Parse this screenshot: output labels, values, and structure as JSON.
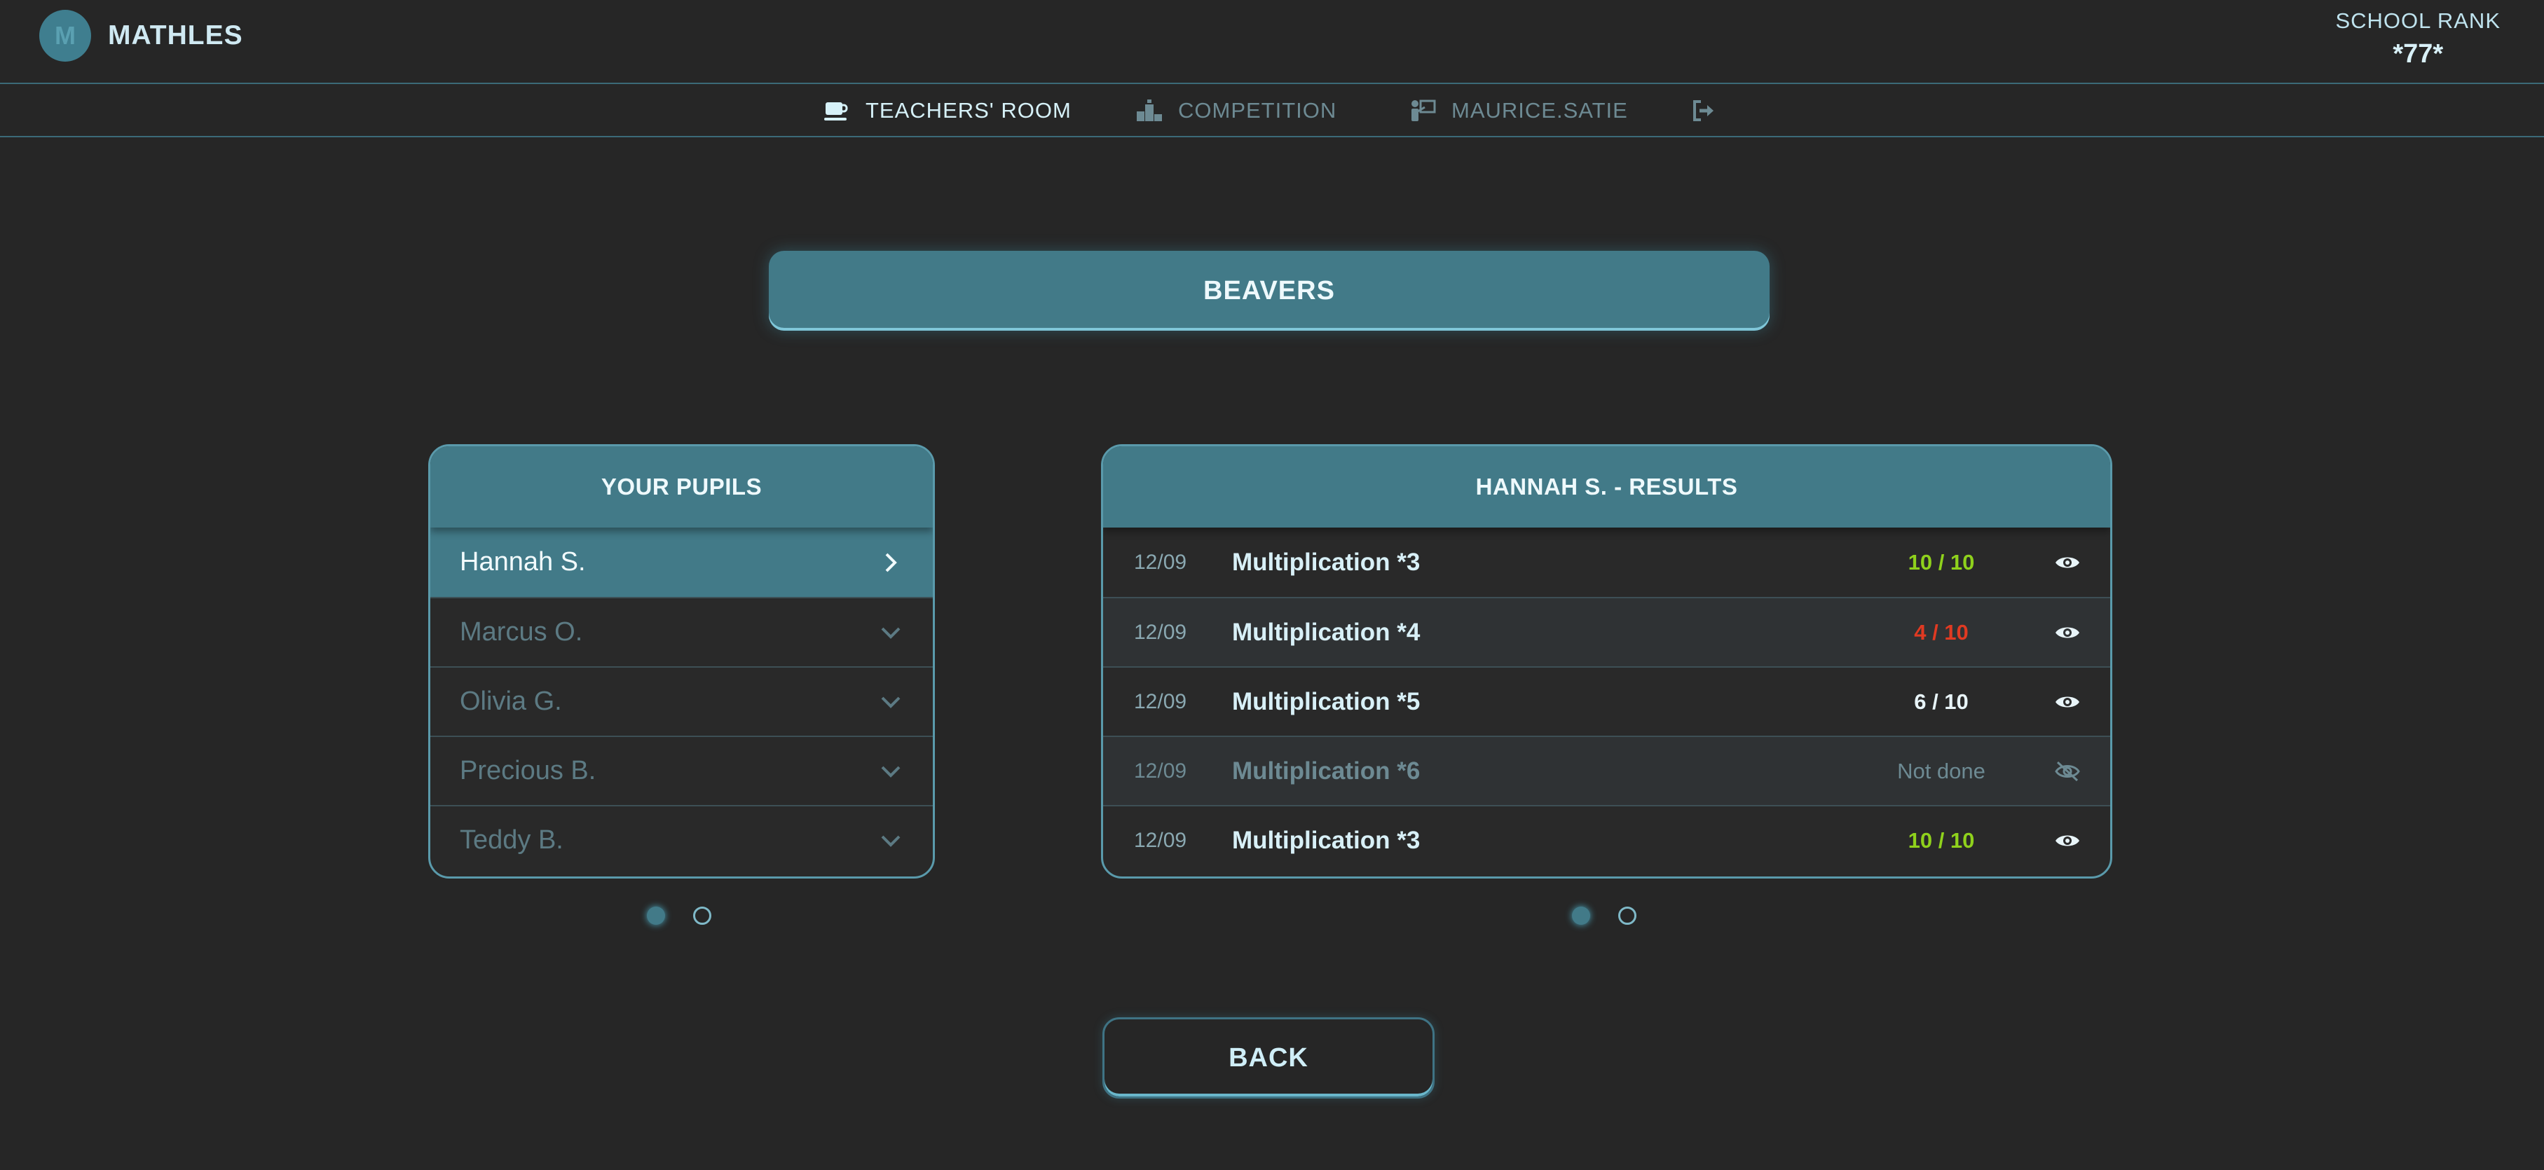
{
  "app": {
    "title": "MATHLES",
    "logo_letter": "M"
  },
  "rank": {
    "label": "SCHOOL RANK",
    "value": "*77*"
  },
  "nav": {
    "items": [
      {
        "label": "TEACHERS' ROOM",
        "icon": "coffee-cup-icon"
      },
      {
        "label": "COMPETITION",
        "icon": "podium-icon"
      },
      {
        "label": "MAURICE.SATIE",
        "icon": "teacher-board-icon"
      },
      {
        "label": "",
        "icon": "sign-out-icon"
      }
    ]
  },
  "group": {
    "name": "BEAVERS"
  },
  "pupils": {
    "title": "YOUR PUPILS",
    "items": [
      {
        "name": "Hannah S.",
        "selected": true
      },
      {
        "name": "Marcus O.",
        "selected": false
      },
      {
        "name": "Olivia G.",
        "selected": false
      },
      {
        "name": "Precious B.",
        "selected": false
      },
      {
        "name": "Teddy B.",
        "selected": false
      }
    ],
    "pagination": {
      "pages": 2,
      "current": 1
    }
  },
  "results": {
    "title": "HANNAH S. - RESULTS",
    "items": [
      {
        "date": "12/09",
        "exercise": "Multiplication *3",
        "score": "10 / 10",
        "status": "perfect",
        "visible": true
      },
      {
        "date": "12/09",
        "exercise": "Multiplication *4",
        "score": "4 / 10",
        "status": "fail",
        "visible": true
      },
      {
        "date": "12/09",
        "exercise": "Multiplication *5",
        "score": "6 / 10",
        "status": "pass",
        "visible": true
      },
      {
        "date": "12/09",
        "exercise": "Multiplication *6",
        "score": "Not done",
        "status": "not-done",
        "visible": false
      },
      {
        "date": "12/09",
        "exercise": "Multiplication *3",
        "score": "10 / 10",
        "status": "perfect",
        "visible": true
      }
    ],
    "pagination": {
      "pages": 2,
      "current": 1
    }
  },
  "actions": {
    "back_label": "BACK"
  },
  "colors": {
    "accent": "#427a88",
    "perfect": "#8fd11c",
    "fail": "#e03a22",
    "pass": "#e8f4f8",
    "not_done": "#6d8a93"
  }
}
